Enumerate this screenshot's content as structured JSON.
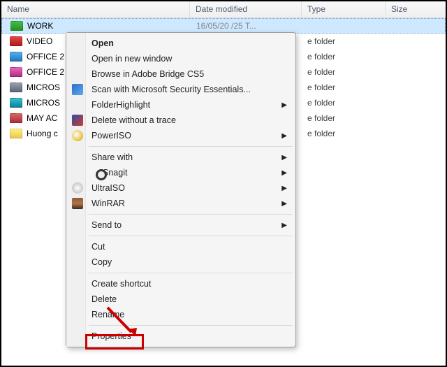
{
  "columns": {
    "name": "Name",
    "date": "Date modified",
    "type": "Type",
    "size": "Size"
  },
  "files": [
    {
      "name": "WORK",
      "color": "green",
      "date": "16/05/20  /25 T...",
      "type": "",
      "selected": true
    },
    {
      "name": "VIDEO",
      "color": "red",
      "date": "",
      "type": "e folder"
    },
    {
      "name": "OFFICE 2",
      "color": "blue",
      "date": "",
      "type": "e folder"
    },
    {
      "name": "OFFICE 2",
      "color": "pink",
      "date": "",
      "type": "e folder"
    },
    {
      "name": "MICROS",
      "color": "gray",
      "date": "",
      "type": "e folder"
    },
    {
      "name": "MICROS",
      "color": "teal",
      "date": "",
      "type": "e folder"
    },
    {
      "name": "MAY AC",
      "color": "rose",
      "date": "",
      "type": "e folder"
    },
    {
      "name": "Huong c",
      "color": "yellow",
      "date": "",
      "type": "e folder"
    }
  ],
  "menu": {
    "open": "Open",
    "open_new": "Open in new window",
    "bridge": "Browse in Adobe Bridge CS5",
    "mse": "Scan with Microsoft Security Essentials...",
    "fh": "FolderHighlight",
    "del_trace": "Delete without a trace",
    "poweriso": "PowerISO",
    "share": "Share with",
    "snagit": "Snagit",
    "ultraiso": "UltraISO",
    "winrar": "WinRAR",
    "sendto": "Send to",
    "cut": "Cut",
    "copy": "Copy",
    "shortcut": "Create shortcut",
    "delete": "Delete",
    "rename": "Rename",
    "properties": "Properties"
  },
  "annotation": {
    "highlights": "properties"
  }
}
